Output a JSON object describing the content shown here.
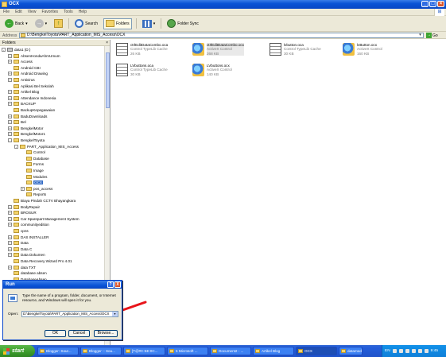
{
  "window": {
    "title": "OCX",
    "menu": [
      "File",
      "Edit",
      "View",
      "Favorites",
      "Tools",
      "Help"
    ]
  },
  "toolbar": {
    "back_label": "Back",
    "search_label": "Search",
    "folders_label": "Folders",
    "folder_sync_label": "Folder Sync"
  },
  "address": {
    "label": "Address",
    "path": "D:\\BengkelToyota\\PART_Application_MIS_Access\\OCX",
    "go_label": "Go"
  },
  "folders": {
    "header": "Folders",
    "items": [
      {
        "label": "data1 (D:)",
        "level": 0,
        "expander": "-",
        "kind": "drive"
      },
      {
        "label": "AbsenHondaAhmUmum",
        "level": 1,
        "expander": "+"
      },
      {
        "label": "Access",
        "level": 1,
        "expander": "+"
      },
      {
        "label": "Android CBI",
        "level": 1,
        "expander": ""
      },
      {
        "label": "Android Drawing",
        "level": 1,
        "expander": "+"
      },
      {
        "label": "Antivirus",
        "level": 1,
        "expander": "+"
      },
      {
        "label": "Aplikasi Bel Sekolah",
        "level": 1,
        "expander": ""
      },
      {
        "label": "Artikel Blog",
        "level": 1,
        "expander": "+"
      },
      {
        "label": "Attendance Indonesia",
        "level": 1,
        "expander": "+"
      },
      {
        "label": "BACKUP",
        "level": 1,
        "expander": "+"
      },
      {
        "label": "BackupKepegawaian",
        "level": 1,
        "expander": ""
      },
      {
        "label": "BaduDownloads",
        "level": 1,
        "expander": "+"
      },
      {
        "label": "Bel",
        "level": 1,
        "expander": "+"
      },
      {
        "label": "BengkelMotor",
        "level": 1,
        "expander": "+"
      },
      {
        "label": "BengkelMotor1",
        "level": 1,
        "expander": "+"
      },
      {
        "label": "BengkelToyota",
        "level": 1,
        "expander": "-"
      },
      {
        "label": "PART_Application_MIS_Access",
        "level": 2,
        "expander": "-"
      },
      {
        "label": "Control",
        "level": 3,
        "expander": ""
      },
      {
        "label": "Database",
        "level": 3,
        "expander": ""
      },
      {
        "label": "Forms",
        "level": 3,
        "expander": ""
      },
      {
        "label": "Image",
        "level": 3,
        "expander": ""
      },
      {
        "label": "Modules",
        "level": 3,
        "expander": ""
      },
      {
        "label": "OCX",
        "level": 3,
        "expander": "",
        "selected": true
      },
      {
        "label": "pos_access",
        "level": 3,
        "expander": "+"
      },
      {
        "label": "Reports",
        "level": 3,
        "expander": ""
      },
      {
        "label": "Biaya Pindah CCTV Bhayangkara",
        "level": 1,
        "expander": ""
      },
      {
        "label": "BodyRepair",
        "level": 1,
        "expander": "+"
      },
      {
        "label": "BROSUR",
        "level": 1,
        "expander": "+"
      },
      {
        "label": "Car Sparepart Management System",
        "level": 1,
        "expander": "+"
      },
      {
        "label": "communityedition",
        "level": 1,
        "expander": "+"
      },
      {
        "label": "cpns",
        "level": 1,
        "expander": ""
      },
      {
        "label": "DAS INSTALLER",
        "level": 1,
        "expander": "+"
      },
      {
        "label": "Data",
        "level": 1,
        "expander": "+"
      },
      {
        "label": "Data C",
        "level": 1,
        "expander": "+"
      },
      {
        "label": "Data Dokumen",
        "level": 1,
        "expander": "+"
      },
      {
        "label": "Data Recovery Wizard Pro 4.01",
        "level": 1,
        "expander": ""
      },
      {
        "label": "data TXT",
        "level": 1,
        "expander": "+"
      },
      {
        "label": "database absen",
        "level": 1,
        "expander": ""
      },
      {
        "label": "DatabaseAbsen",
        "level": 1,
        "expander": ""
      }
    ]
  },
  "files": [
    {
      "name": "ctrlEditDataCombo.oca",
      "type": "Control TypeLib Cache",
      "size": "26 KB",
      "icon": "typelib-icon"
    },
    {
      "name": "ctrlEditDataCombo.ocx",
      "type": "ActiveX Control",
      "size": "268 KB",
      "icon": "activex-icon",
      "selected": true
    },
    {
      "name": "lvbutton.oca",
      "type": "Control TypeLib Cache",
      "size": "30 KB",
      "icon": "typelib-icon"
    },
    {
      "name": "lvButton.ocx",
      "type": "ActiveX Control",
      "size": "160 KB",
      "icon": "activex-icon"
    },
    {
      "name": "LVbuttons.oca",
      "type": "Control TypeLib Cache",
      "size": "30 KB",
      "icon": "typelib-icon"
    },
    {
      "name": "LVbuttons.ocx",
      "type": "ActiveX Control",
      "size": "140 KB",
      "icon": "activex-icon"
    }
  ],
  "run_dialog": {
    "title": "Run",
    "help_label": "?",
    "close_label": "X",
    "description": "Type the name of a program, folder, document, or Internet resource, and Windows will open it for you.",
    "open_label": "Open:",
    "open_value": "D:\\BengkelToyota\\PART_Application_MIS_Access\\OCX",
    "ok_label": "OK",
    "cancel_label": "Cancel",
    "browse_label": "Browse..."
  },
  "taskbar": {
    "start_label": "start",
    "tasks": [
      "Blogger: Sour...",
      "Blogger :: Sou...",
      "[T@#C:5E:0C...",
      "5 Microsoft ...",
      "Document2 - ...",
      "Artikel Blog",
      "OCX",
      "datamode03.1..."
    ],
    "tray_lang": "EN",
    "clock": "9:45"
  },
  "colors": {
    "xp_blue": "#0a53d6",
    "start_green": "#3b9a2b",
    "selection": "#316ac5",
    "arrow_red": "#e8141a"
  }
}
